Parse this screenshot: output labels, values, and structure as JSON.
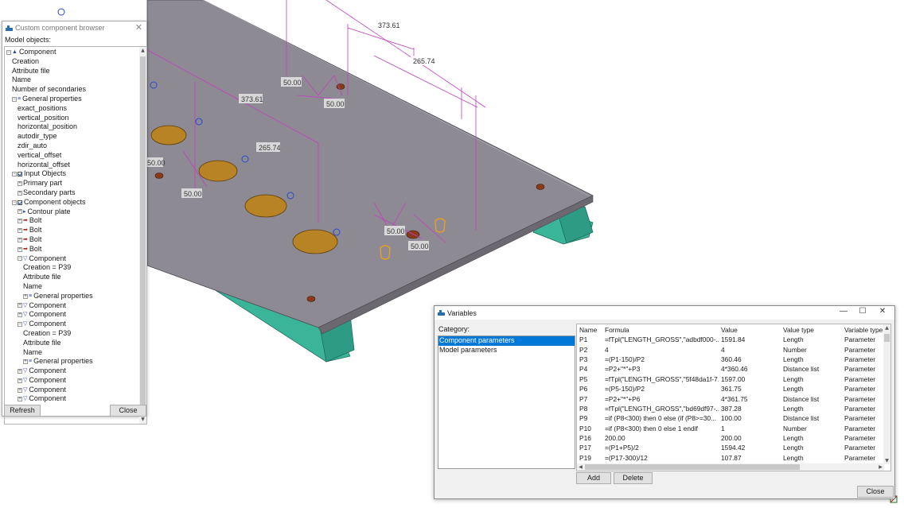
{
  "viewport": {
    "dimension_labels": [
      "373.61",
      "265.74",
      "50.00",
      "50.00",
      "373.61",
      "265.74",
      "50.00",
      "50.00",
      "50.00",
      "50.00",
      "50.00"
    ],
    "colors": {
      "plate": "#8e8a93",
      "beam": "#3bb59a",
      "dimension": "#c040c0",
      "hole": "#b88325",
      "handle": "#e8a020"
    }
  },
  "component_browser": {
    "title": "Custom component browser",
    "model_objects_label": "Model objects:",
    "tree": [
      {
        "label": "Component",
        "level": 0,
        "exp": "⊟",
        "icon": "▲"
      },
      {
        "label": "Creation",
        "level": 1
      },
      {
        "label": "Attribute file",
        "level": 1
      },
      {
        "label": "Name",
        "level": 1
      },
      {
        "label": "Number of secondaries",
        "level": 1
      },
      {
        "label": "General properties",
        "level": 1,
        "exp": "⊟",
        "icon": "≡"
      },
      {
        "label": "exact_positions",
        "level": 2
      },
      {
        "label": "vertical_position",
        "level": 2
      },
      {
        "label": "horizontal_position",
        "level": 2
      },
      {
        "label": "autodir_type",
        "level": 2
      },
      {
        "label": "zdir_auto",
        "level": 2
      },
      {
        "label": "vertical_offset",
        "level": 2
      },
      {
        "label": "horizontal_offset",
        "level": 2
      },
      {
        "label": "Input Objects",
        "level": 1,
        "exp": "⊟",
        "check": true
      },
      {
        "label": "Primary part",
        "level": 2,
        "exp": "⊞"
      },
      {
        "label": "Secondary parts",
        "level": 2,
        "exp": "⊞"
      },
      {
        "label": "Component objects",
        "level": 1,
        "exp": "⊟",
        "check": true
      },
      {
        "label": "Contour plate",
        "level": 2,
        "exp": "⊞",
        "icon": "▸"
      },
      {
        "label": "Bolt",
        "level": 2,
        "exp": "⊞",
        "icon": "➡",
        "red": true
      },
      {
        "label": "Bolt",
        "level": 2,
        "exp": "⊞",
        "icon": "➡",
        "red": true
      },
      {
        "label": "Bolt",
        "level": 2,
        "exp": "⊞",
        "icon": "➡",
        "red": true
      },
      {
        "label": "Bolt",
        "level": 2,
        "exp": "⊞",
        "icon": "➡",
        "red": true
      },
      {
        "label": "Component",
        "level": 2,
        "exp": "⊟",
        "icon": "▽"
      },
      {
        "label": "Creation = P39",
        "level": 3
      },
      {
        "label": "Attribute file",
        "level": 3
      },
      {
        "label": "Name",
        "level": 3
      },
      {
        "label": "General properties",
        "level": 3,
        "exp": "⊞",
        "icon": "≡"
      },
      {
        "label": "Component",
        "level": 2,
        "exp": "⊞",
        "icon": "▽"
      },
      {
        "label": "Component",
        "level": 2,
        "exp": "⊞",
        "icon": "▽"
      },
      {
        "label": "Component",
        "level": 2,
        "exp": "⊟",
        "icon": "▽"
      },
      {
        "label": "Creation = P39",
        "level": 3
      },
      {
        "label": "Attribute file",
        "level": 3
      },
      {
        "label": "Name",
        "level": 3
      },
      {
        "label": "General properties",
        "level": 3,
        "exp": "⊞",
        "icon": "≡"
      },
      {
        "label": "Component",
        "level": 2,
        "exp": "⊞",
        "icon": "▽"
      },
      {
        "label": "Component",
        "level": 2,
        "exp": "⊞",
        "icon": "▽"
      },
      {
        "label": "Component",
        "level": 2,
        "exp": "⊞",
        "icon": "▽"
      },
      {
        "label": "Component",
        "level": 2,
        "exp": "⊞",
        "icon": "▽"
      }
    ],
    "refresh_label": "Refresh",
    "close_label": "Close"
  },
  "variables": {
    "title": "Variables",
    "category_label": "Category:",
    "categories": [
      {
        "label": "Component parameters",
        "selected": true
      },
      {
        "label": "Model parameters",
        "selected": false
      }
    ],
    "columns": [
      "Name",
      "Formula",
      "Value",
      "Value type",
      "Variable type"
    ],
    "rows": [
      [
        "P1",
        "=fTpl(\"LENGTH_GROSS\",\"adbdf000-...",
        "1591.84",
        "Length",
        "Parameter"
      ],
      [
        "P2",
        "4",
        "4",
        "Number",
        "Parameter"
      ],
      [
        "P3",
        "=(P1-150)/P2",
        "360.46",
        "Length",
        "Parameter"
      ],
      [
        "P4",
        "=P2+\"*\"+P3",
        "4*360.46",
        "Distance list",
        "Parameter"
      ],
      [
        "P5",
        "=fTpl(\"LENGTH_GROSS\",\"5f48da1f-7...",
        "1597.00",
        "Length",
        "Parameter"
      ],
      [
        "P6",
        "=(P5-150)/P2",
        "361.75",
        "Length",
        "Parameter"
      ],
      [
        "P7",
        "=P2+\"*\"+P6",
        "4*361.75",
        "Distance list",
        "Parameter"
      ],
      [
        "P8",
        "=fTpl(\"LENGTH_GROSS\",\"bd69df97-...",
        "387.28",
        "Length",
        "Parameter"
      ],
      [
        "P9",
        "=if (P8<300) then 0 else (if (P8>=30...",
        "100.00",
        "Distance list",
        "Parameter"
      ],
      [
        "P10",
        "=if (P8<300) then 0 else 1 endif",
        "1",
        "Number",
        "Parameter"
      ],
      [
        "P16",
        "200.00",
        "200.00",
        "Length",
        "Parameter"
      ],
      [
        "P17",
        "=(P1+P5)/2",
        "1594.42",
        "Length",
        "Parameter"
      ],
      [
        "P19",
        "=(P17-300)/12",
        "107.87",
        "Length",
        "Parameter"
      ]
    ],
    "add_label": "Add",
    "delete_label": "Delete",
    "close_label": "Close"
  }
}
